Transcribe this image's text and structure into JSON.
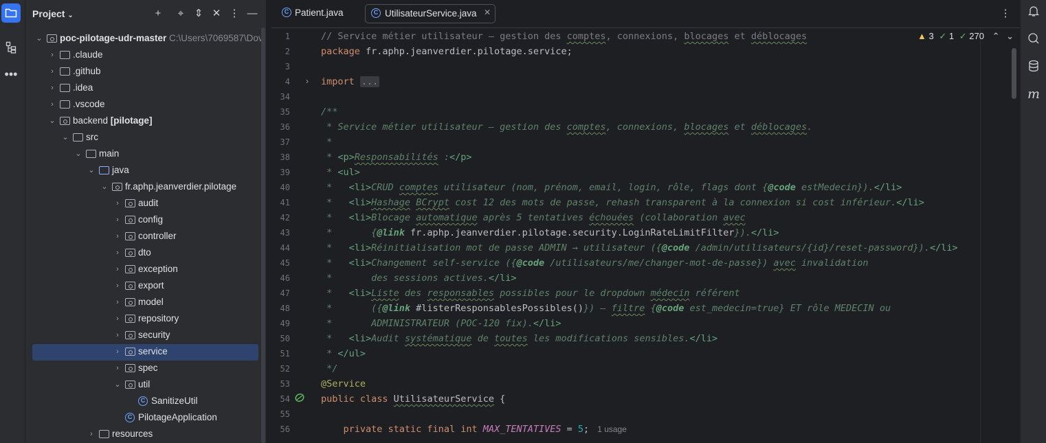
{
  "project_panel": {
    "title": "Project",
    "tree": [
      {
        "label": "poc-pilotage-udr-master",
        "suffix": "C:\\Users\\7069587\\Dov",
        "icon": "module",
        "depth": 0,
        "expanded": true,
        "bold": true
      },
      {
        "label": ".claude",
        "icon": "folder",
        "depth": 1,
        "expanded": false
      },
      {
        "label": ".github",
        "icon": "folder",
        "depth": 1,
        "expanded": false
      },
      {
        "label": ".idea",
        "icon": "folder",
        "depth": 1,
        "expanded": false
      },
      {
        "label": ".vscode",
        "icon": "folder",
        "depth": 1,
        "expanded": false
      },
      {
        "label": "backend",
        "badge": "[pilotage]",
        "icon": "module",
        "depth": 1,
        "expanded": true
      },
      {
        "label": "src",
        "icon": "folder",
        "depth": 2,
        "expanded": true
      },
      {
        "label": "main",
        "icon": "folder",
        "depth": 3,
        "expanded": true
      },
      {
        "label": "java",
        "icon": "source-folder",
        "depth": 4,
        "expanded": true
      },
      {
        "label": "fr.aphp.jeanverdier.pilotage",
        "icon": "package",
        "depth": 5,
        "expanded": true
      },
      {
        "label": "audit",
        "icon": "package",
        "depth": 6,
        "expanded": false
      },
      {
        "label": "config",
        "icon": "package",
        "depth": 6,
        "expanded": false
      },
      {
        "label": "controller",
        "icon": "package",
        "depth": 6,
        "expanded": false
      },
      {
        "label": "dto",
        "icon": "package",
        "depth": 6,
        "expanded": false
      },
      {
        "label": "exception",
        "icon": "package",
        "depth": 6,
        "expanded": false
      },
      {
        "label": "export",
        "icon": "package",
        "depth": 6,
        "expanded": false
      },
      {
        "label": "model",
        "icon": "package",
        "depth": 6,
        "expanded": false
      },
      {
        "label": "repository",
        "icon": "package",
        "depth": 6,
        "expanded": false
      },
      {
        "label": "security",
        "icon": "package",
        "depth": 6,
        "expanded": false
      },
      {
        "label": "service",
        "icon": "package",
        "depth": 6,
        "expanded": false,
        "selected": true
      },
      {
        "label": "spec",
        "icon": "package",
        "depth": 6,
        "expanded": false
      },
      {
        "label": "util",
        "icon": "package",
        "depth": 6,
        "expanded": true
      },
      {
        "label": "SanitizeUtil",
        "icon": "class",
        "depth": 7
      },
      {
        "label": "PilotageApplication",
        "icon": "class",
        "depth": 6
      },
      {
        "label": "resources",
        "icon": "folder",
        "depth": 4,
        "expanded": false
      }
    ]
  },
  "editor": {
    "tabs": [
      {
        "label": "Patient.java",
        "active": false
      },
      {
        "label": "UtilisateurService.java",
        "active": true
      }
    ],
    "inspections": {
      "warnings": "3",
      "weak_warnings": "1",
      "typos": "270"
    },
    "line_numbers": [
      "1",
      "2",
      "3",
      "4",
      "34",
      "35",
      "36",
      "37",
      "38",
      "39",
      "40",
      "41",
      "42",
      "43",
      "44",
      "45",
      "46",
      "47",
      "48",
      "49",
      "50",
      "51",
      "52",
      "53",
      "54",
      "55",
      "56"
    ],
    "lines": [
      [
        [
          "c-com",
          "// Service métier utilisateur — gestion des "
        ],
        [
          "c-com wavy",
          "comptes"
        ],
        [
          "c-com",
          ", connexions, "
        ],
        [
          "c-com wavy",
          "blocages"
        ],
        [
          "c-com",
          " et "
        ],
        [
          "c-com wavy",
          "déblocages"
        ]
      ],
      [
        [
          "c-kw",
          "package "
        ],
        [
          "c-plain",
          "fr.aphp.jeanverdier.pilotage.service;"
        ]
      ],
      [],
      [
        [
          "c-kw",
          "import "
        ],
        [
          "c-plain fold",
          "..."
        ]
      ],
      [],
      [
        [
          "c-doc",
          "/**"
        ]
      ],
      [
        [
          "c-doc",
          " * Service métier utilisateur — gestion des "
        ],
        [
          "c-doc wavy",
          "comptes"
        ],
        [
          "c-doc",
          ", connexions, "
        ],
        [
          "c-doc wavy",
          "blocages"
        ],
        [
          "c-doc",
          " et "
        ],
        [
          "c-doc wavy",
          "déblocages"
        ],
        [
          "c-doc",
          "."
        ]
      ],
      [
        [
          "c-doc",
          " *"
        ]
      ],
      [
        [
          "c-doc",
          " * "
        ],
        [
          "c-tag",
          "<p>"
        ],
        [
          "c-doc wavy",
          "Responsabilités"
        ],
        [
          "c-doc",
          " :"
        ],
        [
          "c-tag",
          "</p>"
        ]
      ],
      [
        [
          "c-doc",
          " * "
        ],
        [
          "c-tag",
          "<ul>"
        ]
      ],
      [
        [
          "c-doc",
          " *   "
        ],
        [
          "c-tag",
          "<li>"
        ],
        [
          "c-doc",
          "CRUD "
        ],
        [
          "c-doc wavy",
          "comptes"
        ],
        [
          "c-doc",
          " utilisateur (nom, prénom, email, login, rôle, flags dont {"
        ],
        [
          "c-dtag",
          "@code"
        ],
        [
          "c-doc",
          " estMedecin})."
        ],
        [
          "c-tag",
          "</li>"
        ]
      ],
      [
        [
          "c-doc",
          " *   "
        ],
        [
          "c-tag",
          "<li>"
        ],
        [
          "c-doc wavy",
          "Hashage"
        ],
        [
          "c-doc",
          " "
        ],
        [
          "c-doc wavy",
          "BCrypt"
        ],
        [
          "c-doc",
          " cost 12 des mots de passe, rehash transparent à la connexion si cost inférieur."
        ],
        [
          "c-tag",
          "</li>"
        ]
      ],
      [
        [
          "c-doc",
          " *   "
        ],
        [
          "c-tag",
          "<li>"
        ],
        [
          "c-doc",
          "Blocage "
        ],
        [
          "c-doc wavy",
          "automatique"
        ],
        [
          "c-doc",
          " après 5 tentatives "
        ],
        [
          "c-doc wavy",
          "échouées"
        ],
        [
          "c-doc",
          " (collaboration "
        ],
        [
          "c-doc wavy",
          "avec"
        ]
      ],
      [
        [
          "c-doc",
          " *       {"
        ],
        [
          "c-dtag",
          "@link"
        ],
        [
          "c-ref",
          " fr.aphp.jeanverdier.pilotage.security.LoginRateLimitFilter"
        ],
        [
          "c-doc",
          "})."
        ],
        [
          "c-tag",
          "</li>"
        ]
      ],
      [
        [
          "c-doc",
          " *   "
        ],
        [
          "c-tag",
          "<li>"
        ],
        [
          "c-doc",
          "Réinitialisation mot de passe ADMIN → utilisateur ({"
        ],
        [
          "c-dtag",
          "@code"
        ],
        [
          "c-doc",
          " /admin/utilisateurs/{id}/reset-password})."
        ],
        [
          "c-tag",
          "</li>"
        ]
      ],
      [
        [
          "c-doc",
          " *   "
        ],
        [
          "c-tag",
          "<li>"
        ],
        [
          "c-doc",
          "Changement self-service ({"
        ],
        [
          "c-dtag",
          "@code"
        ],
        [
          "c-doc",
          " /utilisateurs/me/changer-mot-de-passe}) "
        ],
        [
          "c-doc wavy",
          "avec"
        ],
        [
          "c-doc",
          " invalidation"
        ]
      ],
      [
        [
          "c-doc",
          " *       des sessions actives."
        ],
        [
          "c-tag",
          "</li>"
        ]
      ],
      [
        [
          "c-doc",
          " *   "
        ],
        [
          "c-tag",
          "<li>"
        ],
        [
          "c-doc wavy",
          "Liste"
        ],
        [
          "c-doc",
          " des "
        ],
        [
          "c-doc wavy",
          "responsables"
        ],
        [
          "c-doc",
          " possibles pour le dropdown "
        ],
        [
          "c-doc wavy",
          "médecin"
        ],
        [
          "c-doc",
          " référent"
        ]
      ],
      [
        [
          "c-doc",
          " *       ({"
        ],
        [
          "c-dtag",
          "@link"
        ],
        [
          "c-ref",
          " #listerResponsablesPossibles()"
        ],
        [
          "c-doc",
          "}) — "
        ],
        [
          "c-doc wavy",
          "filtre"
        ],
        [
          "c-doc",
          " {"
        ],
        [
          "c-dtag",
          "@code"
        ],
        [
          "c-doc",
          " est_medecin=true} ET rôle MEDECIN ou"
        ]
      ],
      [
        [
          "c-doc",
          " *       ADMINISTRATEUR (POC-120 fix)."
        ],
        [
          "c-tag",
          "</li>"
        ]
      ],
      [
        [
          "c-doc",
          " *   "
        ],
        [
          "c-tag",
          "<li>"
        ],
        [
          "c-doc",
          "Audit "
        ],
        [
          "c-doc wavy",
          "systématique"
        ],
        [
          "c-doc",
          " de "
        ],
        [
          "c-doc wavy",
          "toutes"
        ],
        [
          "c-doc",
          " les modifications sensibles."
        ],
        [
          "c-tag",
          "</li>"
        ]
      ],
      [
        [
          "c-doc",
          " * "
        ],
        [
          "c-tag",
          "</ul>"
        ]
      ],
      [
        [
          "c-doc",
          " */"
        ]
      ],
      [
        [
          "c-ann",
          "@Service"
        ]
      ],
      [
        [
          "c-kw",
          "public class "
        ],
        [
          "c-plain wavy",
          "UtilisateurService"
        ],
        [
          "c-plain",
          " {"
        ]
      ],
      [],
      [
        [
          "c-plain",
          "    "
        ],
        [
          "c-kw",
          "private static final int "
        ],
        [
          "c-const",
          "MAX_TENTATIVES"
        ],
        [
          "c-plain",
          " = "
        ],
        [
          "c-num",
          "5"
        ],
        [
          "c-plain",
          ";"
        ],
        [
          "hint",
          "1 usage"
        ]
      ]
    ]
  }
}
